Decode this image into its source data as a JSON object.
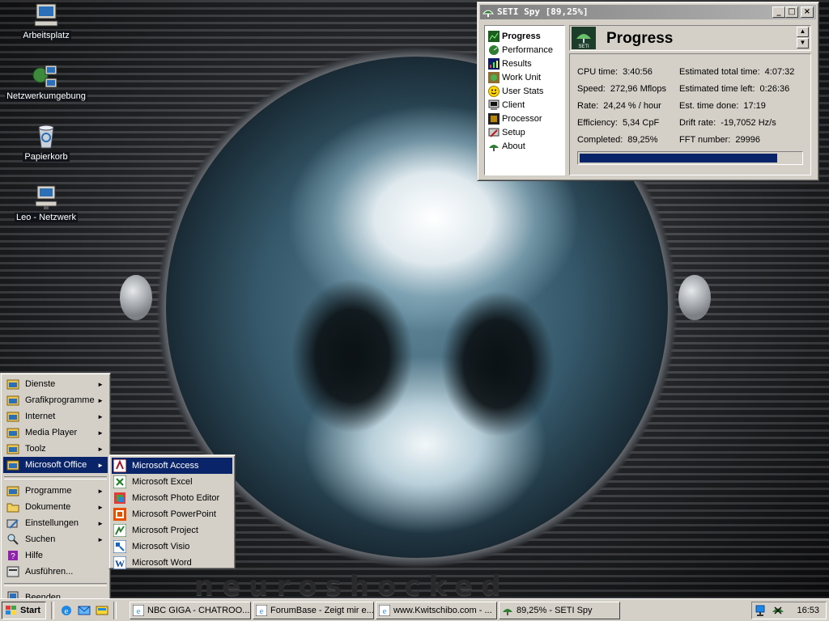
{
  "desktop": {
    "icons": [
      {
        "label": "Arbeitsplatz",
        "icon": "computer-icon"
      },
      {
        "label": "Netzwerkumgebung",
        "icon": "network-icon"
      },
      {
        "label": "Papierkorb",
        "icon": "recycle-bin-icon"
      },
      {
        "label": "Leo - Netzwerk",
        "icon": "network-drive-icon"
      }
    ],
    "wallpaper_text": "neuroshocked"
  },
  "seti_window": {
    "title": "SETI Spy [89,25%]",
    "nav": [
      {
        "label": "Progress",
        "icon": "progress-icon",
        "selected": true
      },
      {
        "label": "Performance",
        "icon": "performance-icon"
      },
      {
        "label": "Results",
        "icon": "results-icon"
      },
      {
        "label": "Work Unit",
        "icon": "work-unit-icon"
      },
      {
        "label": "User Stats",
        "icon": "smiley-icon"
      },
      {
        "label": "Client",
        "icon": "client-icon"
      },
      {
        "label": "Processor",
        "icon": "processor-icon"
      },
      {
        "label": "Setup",
        "icon": "setup-icon"
      },
      {
        "label": "About",
        "icon": "about-icon"
      }
    ],
    "panel_title": "Progress",
    "logo_text": "SETI",
    "stats_left": [
      {
        "label": "CPU time:",
        "value": "3:40:56"
      },
      {
        "label": "Speed:",
        "value": "272,96 Mflops"
      },
      {
        "label": "Rate:",
        "value": "24,24 % / hour"
      },
      {
        "label": "Efficiency:",
        "value": "5,34 CpF"
      },
      {
        "label": "Completed:",
        "value": "89,25%"
      }
    ],
    "stats_right": [
      {
        "label": "Estimated total time:",
        "value": "4:07:32"
      },
      {
        "label": "Estimated time left:",
        "value": "0:26:36"
      },
      {
        "label": "Est. time done:",
        "value": "17:19"
      },
      {
        "label": "Drift rate:",
        "value": "-19,7052 Hz/s"
      },
      {
        "label": "FFT number:",
        "value": "29996"
      }
    ],
    "progress_fraction": 0.8925
  },
  "start_menu": {
    "top_items": [
      {
        "label": "Dienste",
        "submenu": true
      },
      {
        "label": "Grafikprogramme",
        "submenu": true
      },
      {
        "label": "Internet",
        "submenu": true
      },
      {
        "label": "Media Player",
        "submenu": true
      },
      {
        "label": "Toolz",
        "submenu": true
      },
      {
        "label": "Microsoft Office",
        "submenu": true,
        "highlighted": true
      }
    ],
    "main_items": [
      {
        "label": "Programme",
        "icon": "programs-icon",
        "submenu": true
      },
      {
        "label": "Dokumente",
        "icon": "documents-icon",
        "submenu": true
      },
      {
        "label": "Einstellungen",
        "icon": "settings-icon",
        "submenu": true
      },
      {
        "label": "Suchen",
        "icon": "search-icon",
        "submenu": true
      },
      {
        "label": "Hilfe",
        "icon": "help-icon"
      },
      {
        "label": "Ausführen...",
        "icon": "run-icon"
      }
    ],
    "shutdown": "Beenden..."
  },
  "office_submenu": [
    {
      "label": "Microsoft Access",
      "icon": "access-icon",
      "highlighted": true
    },
    {
      "label": "Microsoft Excel",
      "icon": "excel-icon"
    },
    {
      "label": "Microsoft Photo Editor",
      "icon": "photo-editor-icon"
    },
    {
      "label": "Microsoft PowerPoint",
      "icon": "powerpoint-icon"
    },
    {
      "label": "Microsoft Project",
      "icon": "project-icon"
    },
    {
      "label": "Microsoft Visio",
      "icon": "visio-icon"
    },
    {
      "label": "Microsoft Word",
      "icon": "word-icon"
    }
  ],
  "taskbar": {
    "start_label": "Start",
    "tasks": [
      {
        "label": "NBC GIGA - CHATROO...",
        "icon": "ie-icon"
      },
      {
        "label": "ForumBase - Zeigt mir e...",
        "icon": "ie-icon"
      },
      {
        "label": "www.Kwitschibo.com - ...",
        "icon": "ie-icon"
      },
      {
        "label": "89,25% - SETI Spy",
        "icon": "seti-spy-icon"
      }
    ],
    "clock": "16:53"
  }
}
